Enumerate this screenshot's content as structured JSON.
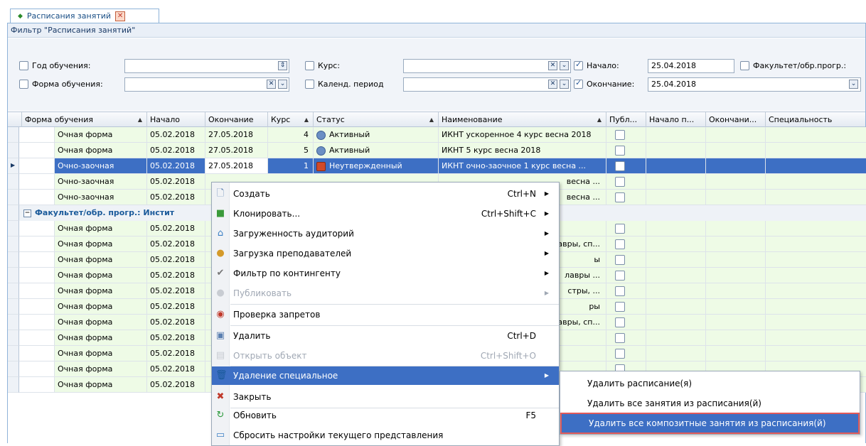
{
  "tab": {
    "label": "Расписания занятий",
    "close": "✕"
  },
  "filter": {
    "title": "Фильтр \"Расписания занятий\"",
    "year_label": "Год обучения:",
    "form_label": "Форма обучения:",
    "course_label": "Курс:",
    "period_label": "Календ. период",
    "start_label": "Начало:",
    "start_value": "25.04.2018",
    "end_label": "Окончание:",
    "end_value": "25.04.2018",
    "faculty_label": "Факультет/обр.прогр.:"
  },
  "columns": [
    "Форма обучения",
    "Начало",
    "Окончание",
    "Курс",
    "Статус",
    "Наименование",
    "Публ...",
    "Начало п...",
    "Окончани...",
    "Специальность"
  ],
  "rows": [
    {
      "form": "Очная форма",
      "start": "05.02.2018",
      "end": "27.05.2018",
      "course": "4",
      "status": "Активный",
      "name": "ИКНТ ускоренное 4 курс весна 2018"
    },
    {
      "form": "Очная форма",
      "start": "05.02.2018",
      "end": "27.05.2018",
      "course": "5",
      "status": "Активный",
      "name": "ИКНТ 5 курс весна 2018"
    },
    {
      "form": "Очно-заочная",
      "start": "05.02.2018",
      "end": "27.05.2018",
      "course": "1",
      "status": "Неутвержденный",
      "name": "ИКНТ очно-заочное 1 курс весна ..."
    },
    {
      "form": "Очно-заочная",
      "start": "05.02.2018",
      "name": "весна ..."
    },
    {
      "form": "Очно-заочная",
      "start": "05.02.2018",
      "name": "весна ..."
    }
  ],
  "group_label": "Факультет/обр. прогр.: Инстит",
  "group_rows": [
    {
      "form": "Очная форма",
      "start": "05.02.2018",
      "name": ""
    },
    {
      "form": "Очная форма",
      "start": "05.02.2018",
      "name": "авры, сп..."
    },
    {
      "form": "Очная форма",
      "start": "05.02.2018",
      "name": "ы"
    },
    {
      "form": "Очная форма",
      "start": "05.02.2018",
      "name": "лавры ..."
    },
    {
      "form": "Очная форма",
      "start": "05.02.2018",
      "name": "стры, ..."
    },
    {
      "form": "Очная форма",
      "start": "05.02.2018",
      "name": "ры"
    },
    {
      "form": "Очная форма",
      "start": "05.02.2018",
      "name": "авры, сп..."
    },
    {
      "form": "Очная форма",
      "start": "05.02.2018",
      "name": ""
    },
    {
      "form": "Очная форма",
      "start": "05.02.2018",
      "name": ""
    },
    {
      "form": "Очная форма",
      "start": "05.02.2018",
      "name": ""
    },
    {
      "form": "Очная форма",
      "start": "05.02.2018",
      "name": ""
    }
  ],
  "context_menu": [
    {
      "label": "Создать",
      "shortcut": "Ctrl+N",
      "icon": "new-document-icon"
    },
    {
      "label": "Клонировать...",
      "shortcut": "Ctrl+Shift+C",
      "icon": "clone-icon"
    },
    {
      "label": "Загруженность аудиторий",
      "shortcut": "",
      "icon": "building-icon"
    },
    {
      "label": "Загрузка преподавателей",
      "shortcut": "",
      "icon": "teacher-icon"
    },
    {
      "label": "Фильтр по контингенту",
      "shortcut": "",
      "icon": "checkmark-icon"
    },
    {
      "label": "Публиковать",
      "shortcut": "",
      "icon": "publish-icon"
    },
    {
      "label": "Проверка запретов",
      "shortcut": "",
      "icon": "forbidden-check-icon"
    },
    {
      "label": "Удалить",
      "shortcut": "Ctrl+D",
      "icon": "delete-icon"
    },
    {
      "label": "Открыть объект",
      "shortcut": "Ctrl+Shift+O",
      "icon": "open-object-icon"
    },
    {
      "label": "Удаление специальное",
      "shortcut": "",
      "icon": "trash-icon"
    },
    {
      "label": "Закрыть",
      "shortcut": "",
      "icon": "close-icon"
    },
    {
      "label": "Обновить",
      "shortcut": "F5",
      "icon": "refresh-icon"
    },
    {
      "label": "Сбросить настройки текущего представления",
      "shortcut": "",
      "icon": "reset-view-icon"
    }
  ],
  "submenu": [
    {
      "label": "Удалить расписание(я)"
    },
    {
      "label": "Удалить все занятия из расписания(й)"
    },
    {
      "label": "Удалить все композитные занятия из расписания(й)"
    }
  ]
}
